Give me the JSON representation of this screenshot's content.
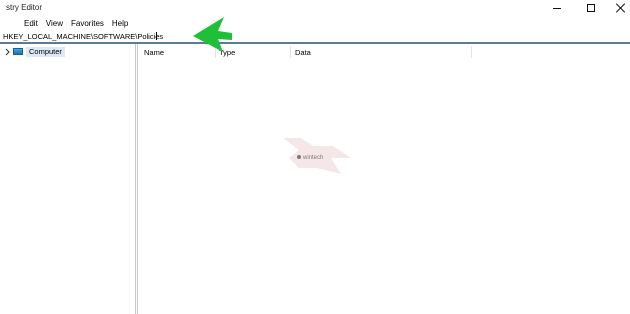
{
  "window": {
    "title": "stry Editor",
    "minimize_icon": "minimize-icon",
    "maximize_icon": "maximize-icon",
    "close_icon": "close-icon"
  },
  "menu": [
    "Edit",
    "View",
    "Favorites",
    "Help"
  ],
  "address": {
    "value": "HKEY_LOCAL_MACHINE\\SOFTWARE\\Policies"
  },
  "tree": {
    "expander_icon": "chevron-right-icon",
    "root": {
      "icon": "computer-icon",
      "label": "Computer"
    }
  },
  "list": {
    "columns": [
      "Name",
      "Type",
      "Data"
    ]
  },
  "watermark": {
    "text": "wintech"
  },
  "annotation": {
    "icon": "green-arrow-icon",
    "color": "#1fbf3a"
  }
}
